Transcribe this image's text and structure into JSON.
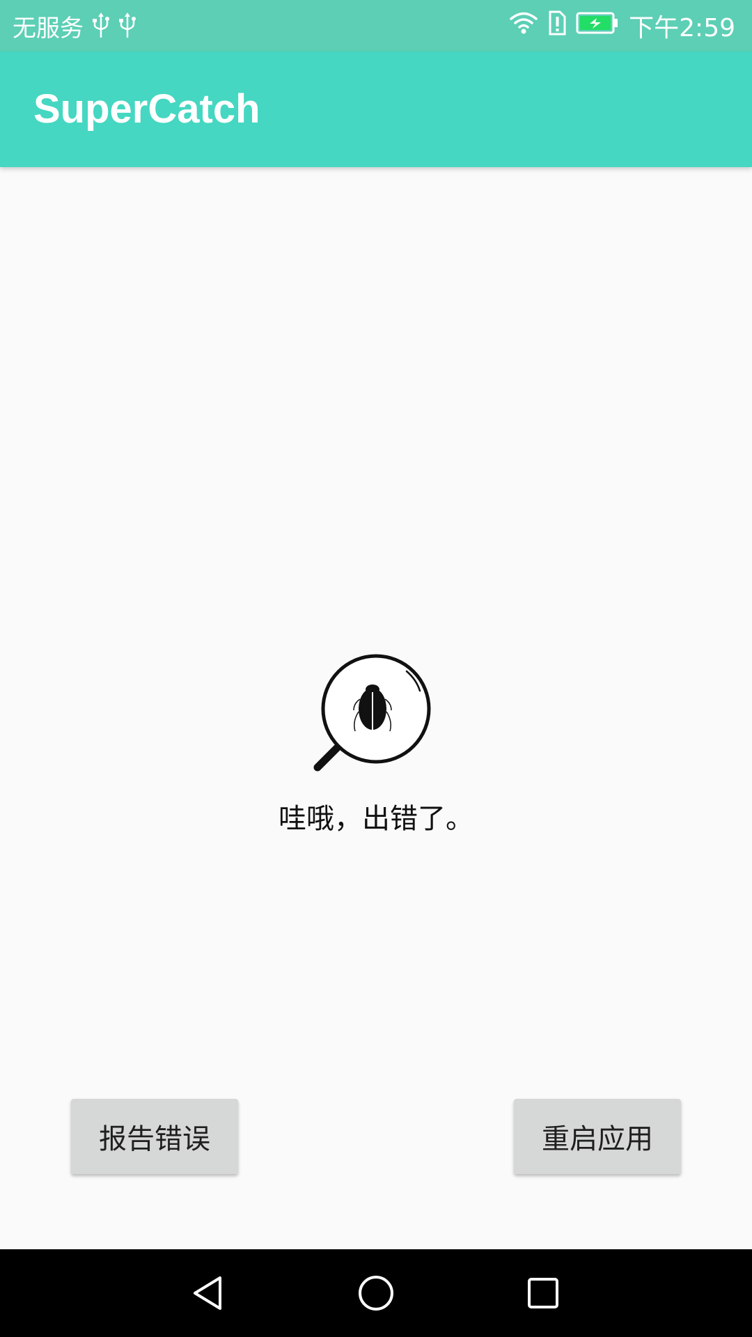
{
  "status_bar": {
    "carrier": "无服务",
    "time": "下午2:59",
    "icons": [
      "usb-icon",
      "usb-icon",
      "wifi-icon",
      "sim-alert-icon",
      "battery-charging-icon"
    ]
  },
  "app_bar": {
    "title": "SuperCatch"
  },
  "main": {
    "icon": "bug-magnifier-icon",
    "message": "哇哦，出错了。"
  },
  "buttons": {
    "report": "报告错误",
    "restart": "重启应用"
  },
  "nav_bar": {
    "icons": [
      "back-icon",
      "home-icon",
      "recents-icon"
    ]
  },
  "colors": {
    "status_bar": "#5ccfb5",
    "app_bar": "#45d7c1",
    "background": "#fafafa",
    "button": "#d6d7d7",
    "battery": "#22dd66"
  }
}
